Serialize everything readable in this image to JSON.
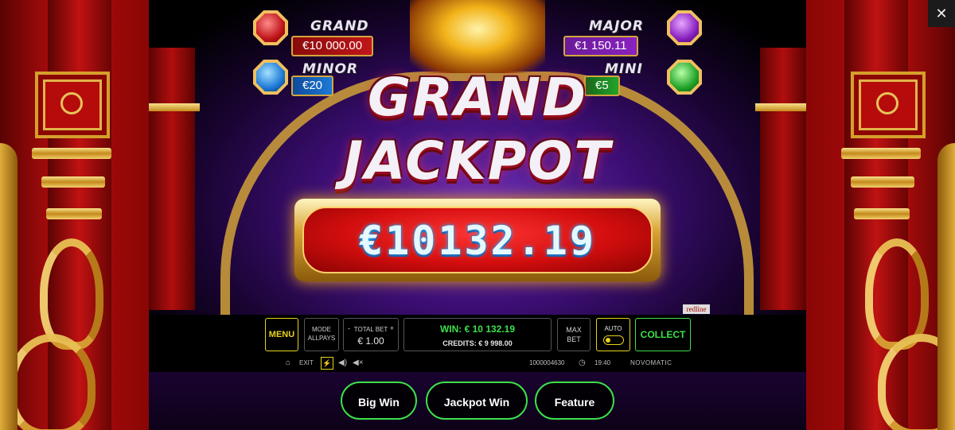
{
  "jackpots": {
    "grand": {
      "name": "GRAND",
      "value": "€10 000.00",
      "color": "#c0161a"
    },
    "major": {
      "name": "MAJOR",
      "value": "€1 150.11",
      "color": "#8a22c0"
    },
    "minor": {
      "name": "MINOR",
      "value": "€20",
      "color": "#1d7ad6"
    },
    "mini": {
      "name": "MINI",
      "value": "€5",
      "color": "#23a32a"
    }
  },
  "overlay": {
    "title_line1": "GRAND",
    "title_line2": "JACKPOT",
    "amount": "€10132.19"
  },
  "controls": {
    "menu": "MENU",
    "mode_label": "MODE",
    "mode_value": "ALLPAYS",
    "total_bet_label": "TOTAL BET",
    "total_bet_minus": "-",
    "total_bet_plus": "+",
    "total_bet_value": "€ 1.00",
    "win_text": "WIN: € 10 132.19",
    "credits_text": "CREDITS: € 9 998.00",
    "max_bet_line1": "MAX",
    "max_bet_line2": "BET",
    "auto_label": "AUTO",
    "collect": "COLLECT"
  },
  "status": {
    "exit": "EXIT",
    "session_id": "1000004630",
    "time": "19:40",
    "brand": "NOVOMATIC",
    "provider_logo": "redline"
  },
  "bottom_buttons": [
    {
      "label": "Big Win"
    },
    {
      "label": "Jackpot Win"
    },
    {
      "label": "Feature"
    }
  ],
  "accent_colors": {
    "green": "#3ee04a",
    "yellow": "#e8d31c",
    "gold": "#d3a53e"
  }
}
